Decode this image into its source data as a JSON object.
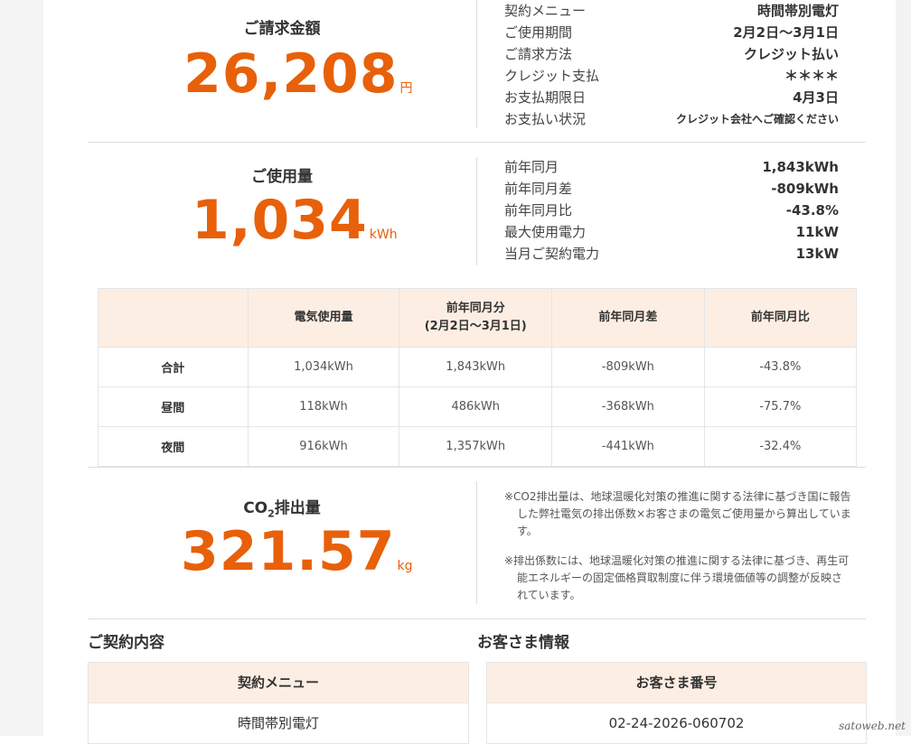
{
  "billing": {
    "label": "ご請求金額",
    "amount": "26,208",
    "unit": "円",
    "details": [
      {
        "key": "契約メニュー",
        "value": "時間帯別電灯"
      },
      {
        "key": "ご使用期間",
        "value": "2月2日〜3月1日"
      },
      {
        "key": "ご請求方法",
        "value": "クレジット払い"
      },
      {
        "key": "クレジット支払",
        "value": "＊＊＊＊"
      },
      {
        "key": "お支払期限日",
        "value": "4月3日"
      },
      {
        "key": "お支払い状況",
        "value": "クレジット会社へご確認ください"
      }
    ]
  },
  "usage": {
    "label": "ご使用量",
    "amount": "1,034",
    "unit": "kWh",
    "details": [
      {
        "key": "前年同月",
        "value": "1,843kWh"
      },
      {
        "key": "前年同月差",
        "value": "-809kWh"
      },
      {
        "key": "前年同月比",
        "value": "-43.8%"
      },
      {
        "key": "最大使用電力",
        "value": "11kW"
      },
      {
        "key": "当月ご契約電力",
        "value": "13kW"
      }
    ]
  },
  "usage_table": {
    "headers": [
      "",
      "電気使用量",
      "前年同月分",
      "前年同月差",
      "前年同月比"
    ],
    "header_sub": "(2月2日〜3月1日)",
    "rows": [
      {
        "name": "合計",
        "cells": [
          "1,034kWh",
          "1,843kWh",
          "-809kWh",
          "-43.8%"
        ]
      },
      {
        "name": "昼間",
        "cells": [
          "118kWh",
          "486kWh",
          "-368kWh",
          "-75.7%"
        ]
      },
      {
        "name": "夜間",
        "cells": [
          "916kWh",
          "1,357kWh",
          "-441kWh",
          "-32.4%"
        ]
      }
    ]
  },
  "co2": {
    "label_prefix": "CO",
    "label_sub": "2",
    "label_suffix": "排出量",
    "amount": "321.57",
    "unit": "kg",
    "notes": [
      "※CO2排出量は、地球温暖化対策の推進に関する法律に基づき国に報告した弊社電気の排出係数×お客さまの電気ご使用量から算出しています。",
      "※排出係数には、地球温暖化対策の推進に関する法律に基づき、再生可能エネルギーの固定価格買取制度に伴う環境価値等の調整が反映されています。"
    ]
  },
  "contract": {
    "title": "ご契約内容",
    "card_head": "契約メニュー",
    "card_value": "時間帯別電灯"
  },
  "customer": {
    "title": "お客さま情報",
    "card_head": "お客さま番号",
    "card_value": "02-24-2026-060702"
  },
  "watermark": "satoweb.net",
  "colors": {
    "accent": "#e8600a",
    "header_bg": "#fdeee3"
  }
}
